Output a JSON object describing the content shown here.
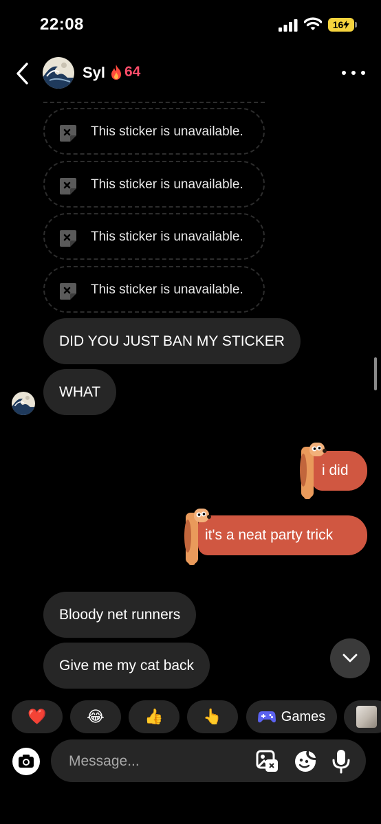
{
  "status_bar": {
    "time": "22:08",
    "battery": "16"
  },
  "header": {
    "contact_name": "Syl",
    "streak_count": "64",
    "icons": [
      "back-chevron-icon",
      "fire-icon",
      "more-dots-icon"
    ]
  },
  "messages": {
    "unavailable_stickers": [
      "This sticker is unavailable.",
      "This sticker is unavailable.",
      "This sticker is unavailable.",
      "This sticker is unavailable."
    ],
    "incoming_1": "DID YOU JUST BAN MY STICKER",
    "incoming_2": "WHAT",
    "outgoing_1": "i did",
    "outgoing_2": "it's a neat party trick",
    "incoming_3": "Bloody net runners",
    "incoming_4": "Give me my cat back"
  },
  "quick_reactions": {
    "items": [
      "❤️",
      "😂",
      "👍",
      "👆"
    ],
    "games_label": "Games"
  },
  "composer": {
    "placeholder": "Message..."
  },
  "colors": {
    "background": "#000000",
    "incoming_bubble": "#262626",
    "outgoing_bubble": "#d05741",
    "streak": "#ff4d6a",
    "battery": "#f5d33d"
  }
}
